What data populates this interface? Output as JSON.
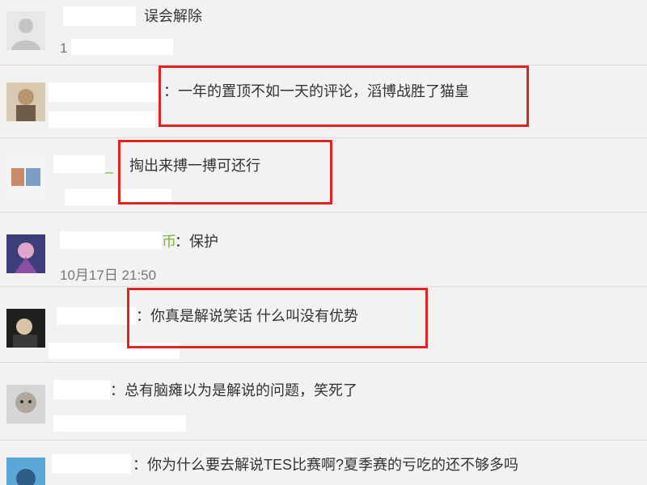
{
  "comments": [
    {
      "name_tail": "",
      "separator": "",
      "text": "误会解除",
      "timestamp": "1"
    },
    {
      "name_tail": "",
      "separator": "：",
      "text": "一年的置顶不如一天的评论，滔博战胜了猫皇",
      "timestamp": ""
    },
    {
      "name_tail": "_",
      "separator": "",
      "text": "掏出来搏一搏可还行",
      "timestamp": ""
    },
    {
      "name_tail": "币",
      "separator": "：",
      "text": "保护",
      "timestamp": "10月17日 21:50"
    },
    {
      "name_tail": "",
      "separator": "：",
      "text": "你真是解说笑话 什么叫没有优势",
      "timestamp": ""
    },
    {
      "name_tail": "",
      "separator": "：",
      "text": "总有脑瘫以为是解说的问题，笑死了",
      "timestamp": ""
    },
    {
      "name_tail": "",
      "separator": "：",
      "text": "你为什么要去解说TES比赛啊?夏季赛的亏吃的还不够多吗",
      "timestamp": ""
    }
  ],
  "colors": {
    "highlight_box": "#e02424",
    "name_accent": "#7cb342",
    "background": "#f2f2f2"
  },
  "icons": [
    "default-avatar-icon",
    "user-avatar-photo"
  ]
}
